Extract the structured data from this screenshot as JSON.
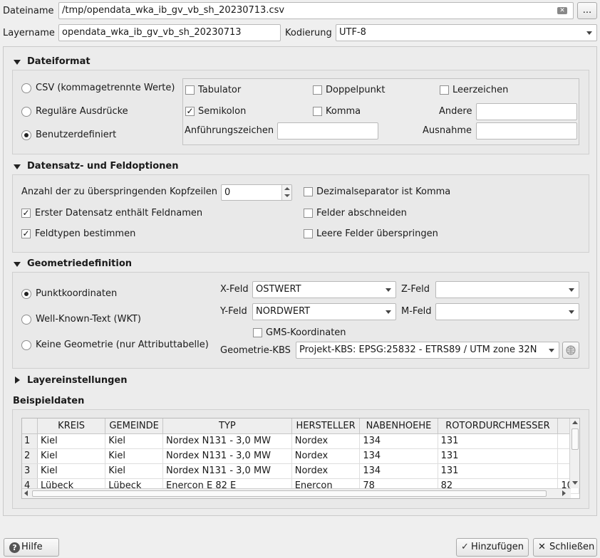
{
  "file": {
    "label": "Dateiname",
    "path": "/tmp/opendata_wka_ib_gv_vb_sh_20230713.csv",
    "browse_label": "..."
  },
  "layer": {
    "label": "Layername",
    "value": "opendata_wka_ib_gv_vb_sh_20230713",
    "encoding_label": "Kodierung",
    "encoding_value": "UTF-8"
  },
  "file_format": {
    "title": "Dateiformat",
    "radio_csv": "CSV (kommagetrennte Werte)",
    "radio_regex": "Reguläre Ausdrücke",
    "radio_custom": "Benutzerdefiniert",
    "tab": "Tabulator",
    "colon": "Doppelpunkt",
    "space": "Leerzeichen",
    "semicolon": "Semikolon",
    "comma": "Komma",
    "other": "Andere",
    "quote": "Anführungszeichen",
    "escape": "Ausnahme",
    "selected": "Benutzerdefiniert",
    "semicolon_checked": true
  },
  "record_options": {
    "title": "Datensatz- und Feldoptionen",
    "skip_label": "Anzahl der zu überspringenden Kopfzeilen",
    "skip_value": "0",
    "first_record": "Erster Datensatz enthält Feldnamen",
    "detect_types": "Feldtypen bestimmen",
    "decimal_comma": "Dezimalseparator ist Komma",
    "trim_fields": "Felder abschneiden",
    "discard_empty": "Leere Felder überspringen"
  },
  "geometry": {
    "title": "Geometriedefinition",
    "radio_point": "Punktkoordinaten",
    "radio_wkt": "Well-Known-Text (WKT)",
    "radio_none": "Keine Geometrie (nur Attributtabelle)",
    "x_label": "X-Feld",
    "x_value": "OSTWERT",
    "y_label": "Y-Feld",
    "y_value": "NORDWERT",
    "z_label": "Z-Feld",
    "m_label": "M-Feld",
    "dms": "GMS-Koordinaten",
    "crs_label": "Geometrie-KBS",
    "crs_value": "Projekt-KBS: EPSG:25832 - ETRS89 / UTM zone 32N"
  },
  "layer_settings": {
    "title": "Layereinstellungen"
  },
  "sample": {
    "title": "Beispieldaten",
    "columns": [
      "KREIS",
      "GEMEINDE",
      "TYP",
      "HERSTELLER",
      "NABENHOEHE",
      "ROTORDURCHMESSER"
    ],
    "rows": [
      [
        "1",
        "Kiel",
        "Kiel",
        "Nordex N131 - 3,0 MW",
        "Nordex",
        "134",
        "131"
      ],
      [
        "2",
        "Kiel",
        "Kiel",
        "Nordex N131 - 3,0 MW",
        "Nordex",
        "134",
        "131"
      ],
      [
        "3",
        "Kiel",
        "Kiel",
        "Nordex N131 - 3,0 MW",
        "Nordex",
        "134",
        "131"
      ],
      [
        "4",
        "Lübeck",
        "Lübeck",
        "Enercon E 82 E",
        "Enercon",
        "78",
        "82"
      ]
    ],
    "overflow_cell": "10"
  },
  "buttons": {
    "help": "Hilfe",
    "add": "Hinzufügen",
    "close": "Schließen"
  }
}
